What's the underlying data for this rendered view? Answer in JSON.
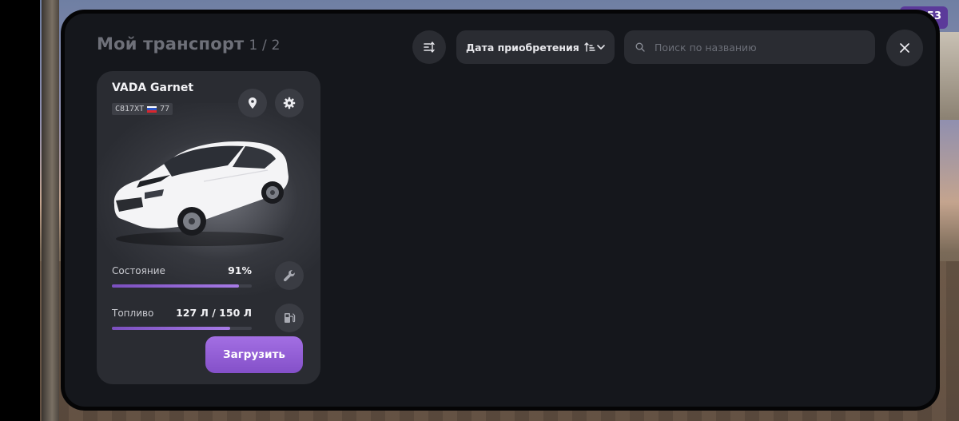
{
  "header": {
    "title": "Мой транспорт",
    "page_counter": "1 / 2"
  },
  "sort": {
    "selected": "Дата приобретения",
    "icon": "sort-arrows-icon"
  },
  "search": {
    "placeholder": "Поиск по названию",
    "value": ""
  },
  "hud": {
    "corner_number": "53"
  },
  "vehicles": [
    {
      "name": "VADA Garnet",
      "plate": "С817ХТ",
      "region": "77",
      "condition_label": "Состояние",
      "condition_value": "91%",
      "condition_fraction": 0.91,
      "fuel_label": "Топливо",
      "fuel_value": "127 Л / 150 Л",
      "fuel_fraction": 0.847,
      "load_label": "Загрузить"
    }
  ],
  "colors": {
    "accent": "#9a65dd",
    "panel": "#15171c",
    "card": "#2a2c32"
  }
}
